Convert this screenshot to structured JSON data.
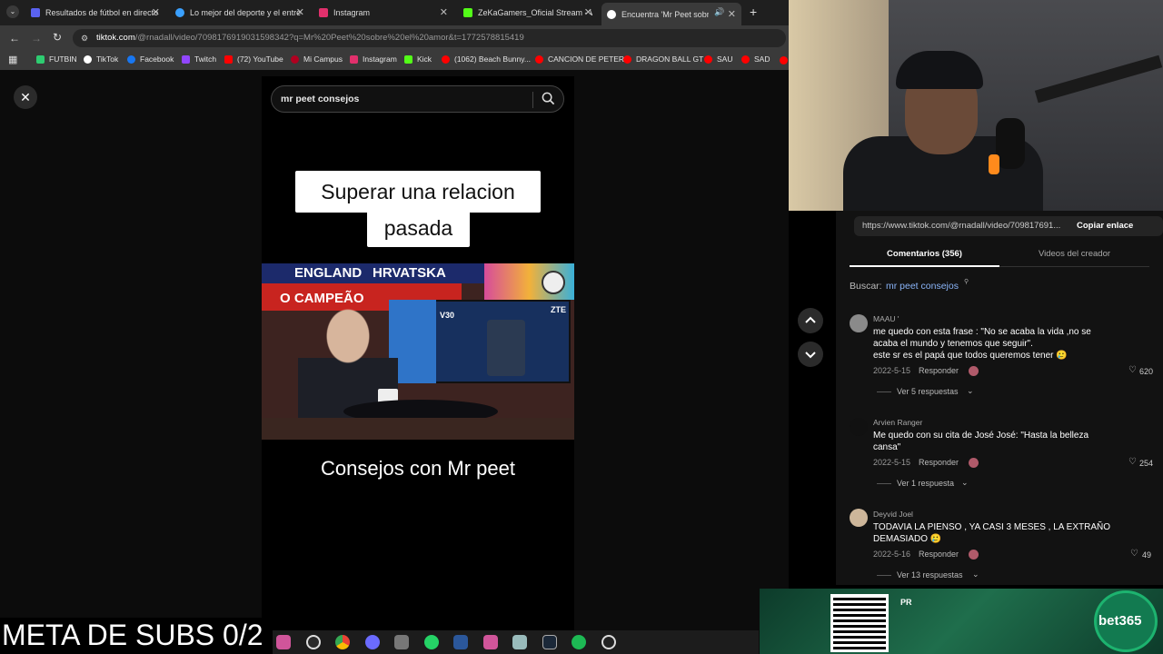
{
  "browser": {
    "tabs": [
      {
        "title": "Resultados de fútbol en directo",
        "color": "#5a62f0"
      },
      {
        "title": "Lo mejor del deporte y el entre",
        "color": "#3aa0ff"
      },
      {
        "title": "Instagram",
        "color": "#e1306c"
      },
      {
        "title": "ZeKaGamers_Oficial Stream - W",
        "color": "#53fc18"
      },
      {
        "title": "Encuentra 'Mr Peet sobre el",
        "color": "#ffffff"
      }
    ],
    "new_tab": "+",
    "url_domain": "tiktok.com",
    "url_rest": "/@rnadall/video/7098176919031598342?q=Mr%20Peet%20sobre%20el%20amor&t=1772578815419",
    "bookmarks": [
      {
        "label": "FUTBIN",
        "color": "#2ecc71"
      },
      {
        "label": "TikTok",
        "color": "#ffffff"
      },
      {
        "label": "Facebook",
        "color": "#1877f2"
      },
      {
        "label": "Twitch",
        "color": "#9146ff"
      },
      {
        "label": "(72) YouTube",
        "color": "#ff0000"
      },
      {
        "label": "Mi Campus",
        "color": "#b00020"
      },
      {
        "label": "Instagram",
        "color": "#e1306c"
      },
      {
        "label": "Kick",
        "color": "#53fc18"
      },
      {
        "label": "(1062) Beach Bunny...",
        "color": "#ff0000"
      },
      {
        "label": "CANCION DE PETER",
        "color": "#ff0000"
      },
      {
        "label": "DRAGON BALL GT",
        "color": "#ff0000"
      },
      {
        "label": "SAU",
        "color": "#ff0000"
      },
      {
        "label": "SAD",
        "color": "#ff0000"
      }
    ]
  },
  "tiktok": {
    "search_value": "mr peet consejos",
    "video_caption_line1": "Superar una relacion",
    "video_caption_line2": "pasada",
    "video_bottom_text": "Consejos con Mr peet",
    "scene_banner_left": "ENGLAND",
    "scene_banner_mid": "HRVATSKA",
    "scene_banner_lower": "O CAMPEÃO",
    "scene_brand": "ZTE",
    "scene_model": "V30",
    "copy_url": "https://www.tiktok.com/@rnadall/video/709817691...",
    "copy_button": "Copiar enlace",
    "tab_comments": "Comentarios (356)",
    "tab_creator": "Videos del creador",
    "search_label": "Buscar:",
    "search_term": "mr peet consejos",
    "comments": [
      {
        "user": "MAAU '",
        "lines": [
          "me quedo con esta frase : \"No se acaba la vida ,no se",
          "acaba el mundo y tenemos que seguir\".",
          "este sr es el papá que todos queremos tener 🥲"
        ],
        "date": "2022-5-15",
        "reply": "Responder",
        "likes": "620",
        "more": "Ver 5 respuestas"
      },
      {
        "user": "Arvien Ranger",
        "lines": [
          "Me quedo con su cita de José José: \"Hasta la belleza",
          "cansa\""
        ],
        "date": "2022-5-15",
        "reply": "Responder",
        "likes": "254",
        "more": "Ver 1 respuesta"
      },
      {
        "user": "Deyvid Joel",
        "lines": [
          "TODAVIA LA PIENSO , YA CASI 3 MESES , LA EXTRAÑO",
          "DEMASIADO 🥲"
        ],
        "date": "2022-5-16",
        "reply": "Responder",
        "likes": "49",
        "more": "Ver 13 respuestas"
      }
    ]
  },
  "stream": {
    "subs_goal": "META DE SUBS 0/2",
    "ad_brand": "bet365",
    "ad_small": "PR"
  }
}
